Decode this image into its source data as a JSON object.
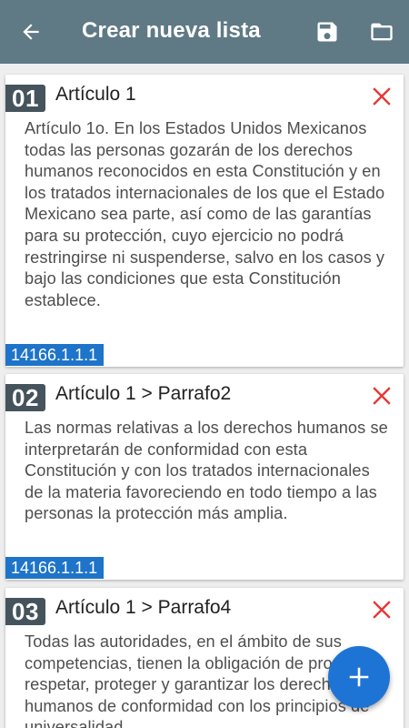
{
  "appbar": {
    "title": "Crear nueva lista",
    "back_icon": "arrow-back-icon",
    "save_icon": "save-icon",
    "folder_icon": "folder-icon",
    "background": "#5f7a85"
  },
  "items": [
    {
      "number": "01",
      "title": "Artículo  1",
      "body": "Artículo 1o. En los Estados Unidos Mexicanos todas las personas gozarán de los derechos humanos reconocidos en esta Constitución y en los tratados internacionales de los que el Estado Mexicano sea parte, así como de las garantías para su protección, cuyo ejercicio no podrá restringirse ni suspenderse, salvo en los casos y bajo las condiciones que esta Constitución establece.",
      "ref": "14166.1.1.1"
    },
    {
      "number": "02",
      "title": "Artículo  1 > Parrafo2",
      "body": "Las normas relativas a los derechos humanos se interpretarán de conformidad con esta Constitución y con los tratados internacionales de la materia favoreciendo en todo tiempo a las personas la protección más amplia.",
      "ref": "14166.1.1.1"
    },
    {
      "number": "03",
      "title": "Artículo  1 > Parrafo4",
      "body": "Todas las autoridades, en el ámbito de sus competencias, tienen la obligación de promover, respetar, proteger y garantizar los derechos humanos de conformidad con los principios de universalidad,",
      "ref": ""
    }
  ],
  "fab": {
    "label": "+",
    "icon": "add-icon",
    "color": "#1e74d4"
  },
  "colors": {
    "delete": "#e53935",
    "badge": "#45545c",
    "ref_tag": "#1e74c9"
  }
}
